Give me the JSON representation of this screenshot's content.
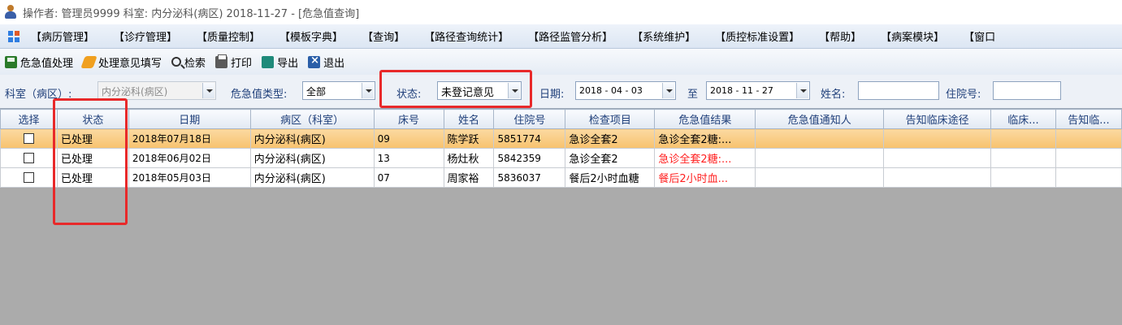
{
  "title": {
    "text": "操作者: 管理员9999  科室: 内分泌科(病区)  2018-11-27 - [危急值查询]"
  },
  "menu": [
    "【病历管理】",
    "【诊疗管理】",
    "【质量控制】",
    "【模板字典】",
    "【查询】",
    "【路径查询统计】",
    "【路径监管分析】",
    "【系统维护】",
    "【质控标准设置】",
    "【帮助】",
    "【病案模块】",
    "【窗口"
  ],
  "toolbar": {
    "critical_handle": "危急值处理",
    "opinion_fill": "处理意见填写",
    "search": "检索",
    "print": "打印",
    "export": "导出",
    "exit": "退出"
  },
  "filters": {
    "dept_label": "科室（病区）:",
    "dept_value": "内分泌科(病区)",
    "type_label": "危急值类型:",
    "type_value": "全部",
    "status_label": "状态:",
    "status_value": "未登记意见",
    "date_label": "日期:",
    "date_from": "2018 - 04 - 03",
    "to_label": "至",
    "date_to": "2018 - 11 - 27",
    "name_label": "姓名:",
    "name_value": "",
    "inpatient_label": "住院号:",
    "inpatient_value": ""
  },
  "table": {
    "columns": [
      "选择",
      "状态",
      "日期",
      "病区（科室）",
      "床号",
      "姓名",
      "住院号",
      "检查项目",
      "危急值结果",
      "危急值通知人",
      "告知临床途径",
      "临床...",
      "告知临..."
    ],
    "rows": [
      [
        "",
        "已处理",
        "2018年07月18日",
        "内分泌科(病区)",
        "09",
        "陈学跃",
        "5851774",
        "急诊全套2",
        "急诊全套2糖:...",
        "",
        "",
        "",
        ""
      ],
      [
        "",
        "已处理",
        "2018年06月02日",
        "内分泌科(病区)",
        "13",
        "杨灶秋",
        "5842359",
        "急诊全套2",
        "急诊全套2糖:...",
        "",
        "",
        "",
        ""
      ],
      [
        "",
        "已处理",
        "2018年05月03日",
        "内分泌科(病区)",
        "07",
        "周家裕",
        "5836037",
        "餐后2小时血糖",
        "餐后2小时血...",
        "",
        "",
        "",
        ""
      ]
    ],
    "selected_row": 0
  },
  "colors": {
    "highlight": "#e8292a",
    "selected_row": "#f7c26e",
    "critical_text": "#ff2020"
  }
}
